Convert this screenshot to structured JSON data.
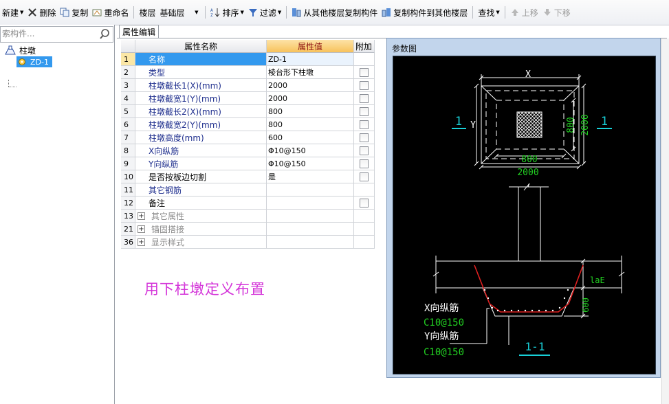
{
  "toolbar": {
    "new_label": "新建",
    "delete_label": "删除",
    "copy_label": "复制",
    "rename_label": "重命名",
    "floor_label": "楼层",
    "floor_value": "基础层",
    "sort_label": "排序",
    "filter_label": "过滤",
    "copy_from_floor_label": "从其他楼层复制构件",
    "copy_to_floor_label": "复制构件到其他楼层",
    "find_label": "查找",
    "move_up_label": "上移",
    "move_down_label": "下移"
  },
  "search": {
    "placeholder": "索构件..."
  },
  "tree": {
    "root_label": "柱墩",
    "child_label": "ZD-1"
  },
  "tabs": {
    "properties": "属性编辑"
  },
  "grid": {
    "headers": {
      "name": "属性名称",
      "value": "属性值",
      "extra": "附加"
    },
    "rows": [
      {
        "num": "1",
        "name": "名称",
        "value": "ZD-1"
      },
      {
        "num": "2",
        "name": "类型",
        "value": "棱台形下柱墩"
      },
      {
        "num": "3",
        "name": "柱墩截长1(X)(mm)",
        "value": "2000"
      },
      {
        "num": "4",
        "name": "柱墩截宽1(Y)(mm)",
        "value": "2000"
      },
      {
        "num": "5",
        "name": "柱墩截长2(X)(mm)",
        "value": "800"
      },
      {
        "num": "6",
        "name": "柱墩截宽2(Y)(mm)",
        "value": "800"
      },
      {
        "num": "7",
        "name": "柱墩高度(mm)",
        "value": "600"
      },
      {
        "num": "8",
        "name": "X向纵筋",
        "value": "Φ10@150"
      },
      {
        "num": "9",
        "name": "Y向纵筋",
        "value": "Φ10@150"
      },
      {
        "num": "10",
        "name": "是否按板边切割",
        "value": "是"
      },
      {
        "num": "11",
        "name": "其它钢筋",
        "value": ""
      },
      {
        "num": "12",
        "name": "备注",
        "value": ""
      },
      {
        "num": "13",
        "name": "其它属性",
        "value": ""
      },
      {
        "num": "21",
        "name": "锚固搭接",
        "value": ""
      },
      {
        "num": "36",
        "name": "显示样式",
        "value": ""
      }
    ]
  },
  "annotation": "用下柱墩定义布置",
  "param_panel": {
    "title": "参数图",
    "plan": {
      "x_label": "X",
      "y_label": "Y",
      "section_mark": "1",
      "inner_width": "800",
      "outer_width": "2000",
      "inner_height": "800",
      "outer_height": "2000"
    },
    "section": {
      "lae": "laE",
      "height": "600",
      "x_rebar_label": "X向纵筋",
      "x_rebar_spec": "C10@150",
      "y_rebar_label": "Y向纵筋",
      "y_rebar_spec": "C10@150",
      "title": "1-1"
    }
  },
  "colors": {
    "accent_blue": "#3399ee",
    "annotation": "#d436d9",
    "cad_green": "#22d022",
    "cad_cyan": "#18d0d8",
    "rebar_red": "#e02020"
  }
}
